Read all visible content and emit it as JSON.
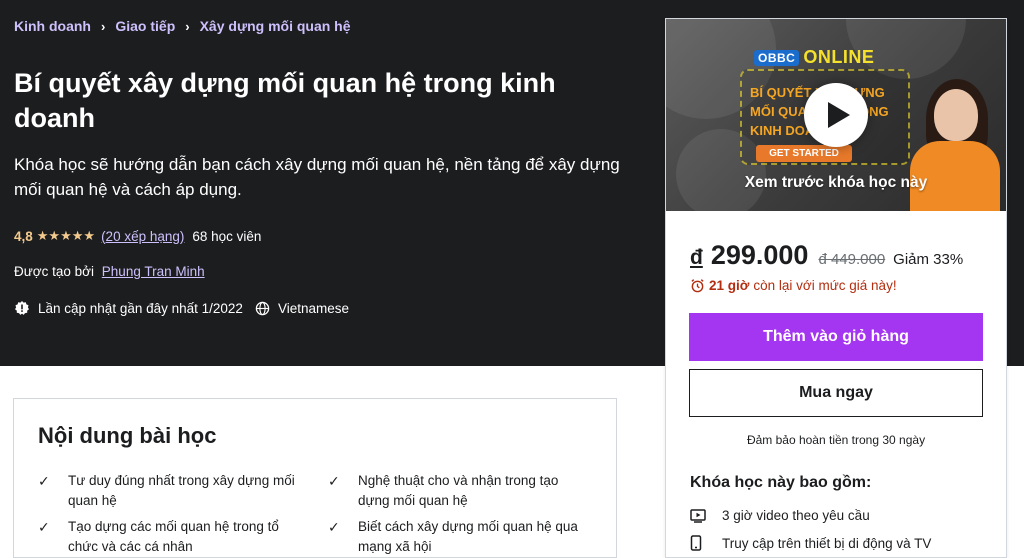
{
  "breadcrumb": [
    "Kinh doanh",
    "Giao tiếp",
    "Xây dựng mối quan hệ"
  ],
  "course": {
    "title": "Bí quyết xây dựng mối quan hệ trong kinh doanh",
    "subtitle": "Khóa học sẽ hướng dẫn bạn cách xây dựng mối quan hệ, nền tảng để xây dựng mối quan hệ và cách áp dụng.",
    "rating": "4,8",
    "stars": "★★★★★",
    "rating_count": "(20 xếp hạng)",
    "students": "68 học viên",
    "created_by_label": "Được tạo bởi",
    "instructor": "Phung Tran Minh",
    "last_updated": "Lần cập nhật gần đây nhất 1/2022",
    "language": "Vietnamese"
  },
  "content": {
    "title": "Nội dung bài học",
    "items": [
      "Tư duy đúng nhất trong xây dựng mối quan hệ",
      "Nghệ thuật cho và nhận trong tạo dựng mối quan hệ",
      "Tạo dựng các mối quan hệ trong tổ chức và các cá nhân",
      "Biết cách xây dựng mối quan hệ qua mạng xã hội"
    ]
  },
  "sidebar": {
    "preview": {
      "logo_badge": "OBBC",
      "logo_text": "ONLINE",
      "poster_text": "BÍ QUYẾT XÂY DỰNG MỐI QUAN HỆ TRONG KINH DOANH",
      "get_started": "GET STARTED",
      "label": "Xem trước khóa học này"
    },
    "currency": "đ",
    "price": "299.000",
    "old_price": "đ 449.000",
    "discount": "Giảm 33%",
    "timer_hours": "21 giờ",
    "timer_text": "còn lại với mức giá này!",
    "add_to_cart": "Thêm vào giỏ hàng",
    "buy_now": "Mua ngay",
    "guarantee": "Đảm bảo hoàn tiền trong 30 ngày",
    "includes_title": "Khóa học này bao gồm:",
    "includes": [
      {
        "icon": "video-icon",
        "text": "3 giờ video theo yêu cầu"
      },
      {
        "icon": "mobile-icon",
        "text": "Truy cập trên thiết bị di động và TV"
      }
    ]
  },
  "colors": {
    "hero_bg": "#1c1d1f",
    "link_purple": "#cec0fc",
    "star_gold": "#f3ca8c",
    "cta_purple": "#a435f0",
    "timer_red": "#b32d0f"
  }
}
